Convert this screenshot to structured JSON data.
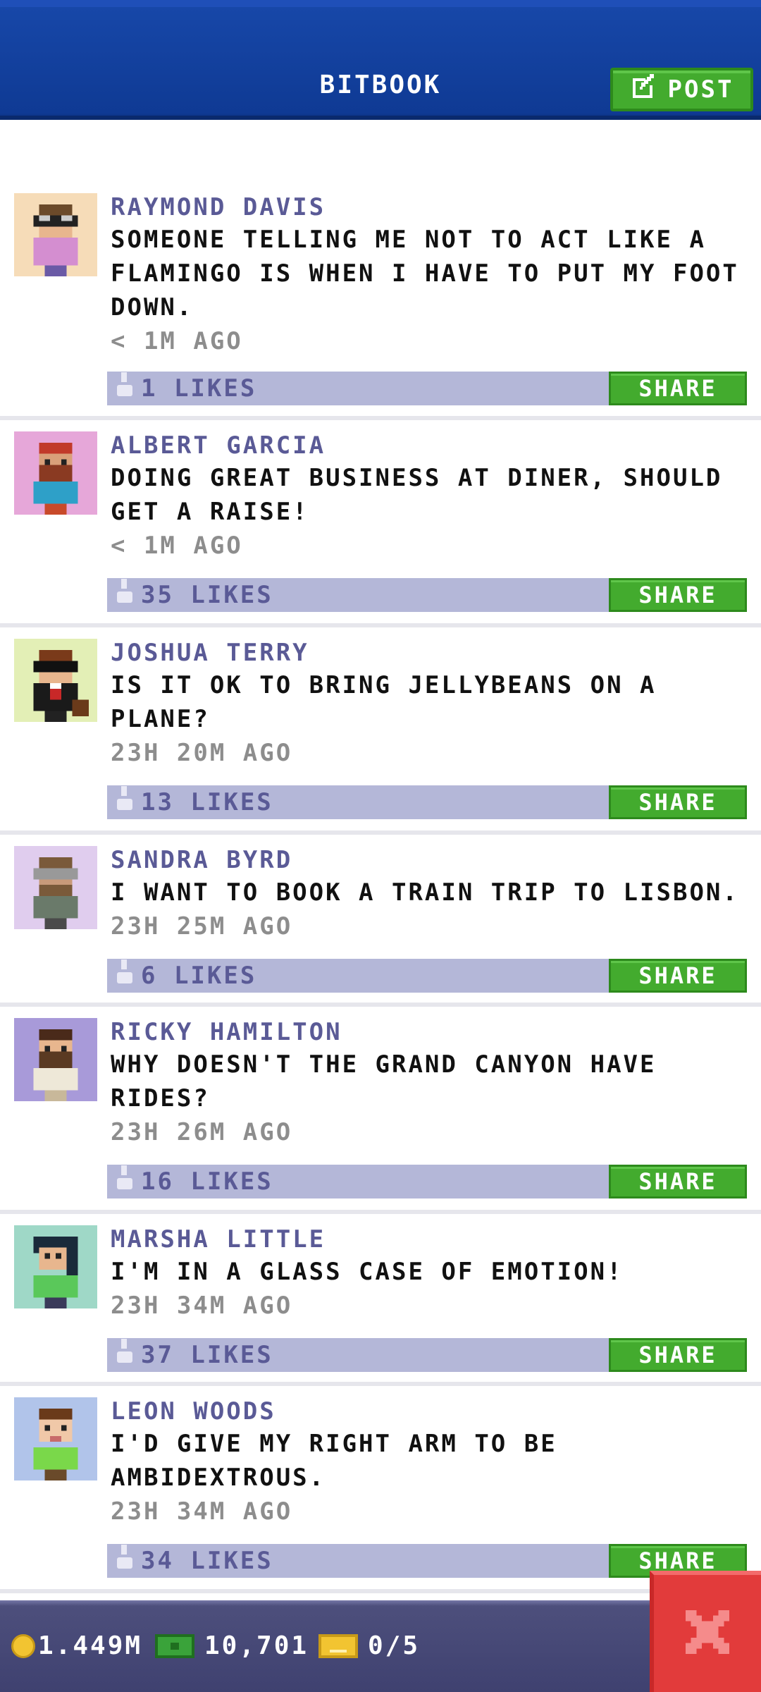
{
  "header": {
    "title": "BITBOOK",
    "post_label": "POST"
  },
  "posts": [
    {
      "author": "RAYMOND DAVIS",
      "lines": [
        "SOMEONE TELLING ME NOT TO ACT LIKE A",
        "FLAMINGO IS WHEN I HAVE TO PUT MY FOOT",
        "DOWN."
      ],
      "time": "< 1M AGO",
      "likes": "1 LIKES",
      "share": "SHARE",
      "avatar_bg": "#f6dcb8"
    },
    {
      "author": "ALBERT GARCIA",
      "lines": [
        "DOING GREAT BUSINESS AT DINER, SHOULD",
        "GET A RAISE!"
      ],
      "time": "< 1M AGO",
      "likes": "35 LIKES",
      "share": "SHARE",
      "avatar_bg": "#e6a7d9"
    },
    {
      "author": "JOSHUA TERRY",
      "lines": [
        "IS IT OK TO BRING JELLYBEANS ON A",
        "PLANE?"
      ],
      "time": "23H 20M AGO",
      "likes": "13 LIKES",
      "share": "SHARE",
      "avatar_bg": "#e3efb6"
    },
    {
      "author": "SANDRA BYRD",
      "lines": [
        "I WANT TO BOOK A TRAIN TRIP TO LISBON."
      ],
      "time": "23H 25M AGO",
      "likes": "6 LIKES",
      "share": "SHARE",
      "avatar_bg": "#e0cdee"
    },
    {
      "author": "RICKY HAMILTON",
      "lines": [
        "WHY DOESN'T THE GRAND CANYON HAVE",
        "RIDES?"
      ],
      "time": "23H 26M AGO",
      "likes": "16 LIKES",
      "share": "SHARE",
      "avatar_bg": "#a89ad9"
    },
    {
      "author": "MARSHA LITTLE",
      "lines": [
        "I'M IN A GLASS CASE OF EMOTION!"
      ],
      "time": "23H 34M AGO",
      "likes": "37 LIKES",
      "share": "SHARE",
      "avatar_bg": "#9fd8c7"
    },
    {
      "author": "LEON WOODS",
      "lines": [
        "I'D GIVE MY RIGHT ARM TO BE",
        "AMBIDEXTROUS."
      ],
      "time": "23H 34M AGO",
      "likes": "34 LIKES",
      "share": "SHARE",
      "avatar_bg": "#b1c4ea"
    }
  ],
  "status": {
    "coins": "1.449M",
    "bux": "10,701",
    "tickets": "0/5"
  },
  "colors": {
    "header_blue": "#0f3a94",
    "share_green": "#43ab2e",
    "likes_bar": "#b4b7d8",
    "close_red": "#e23b3b"
  }
}
